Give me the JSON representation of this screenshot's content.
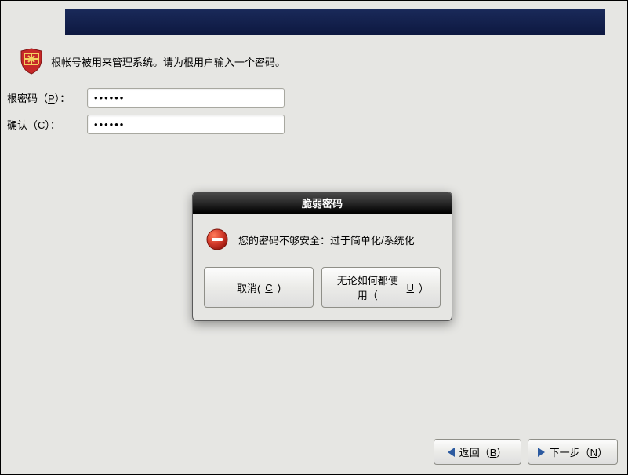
{
  "banner": {
    "title": ""
  },
  "intro": {
    "icon": "shield-icon",
    "text": "根帐号被用来管理系统。请为根用户输入一个密码。"
  },
  "form": {
    "root_password": {
      "label_prefix": "根密码（",
      "accel": "P",
      "label_suffix": "）：",
      "value": "••••••"
    },
    "confirm": {
      "label_prefix": "确认（",
      "accel": "C",
      "label_suffix": "）：",
      "value": "••••••"
    }
  },
  "dialog": {
    "title": "脆弱密码",
    "message": "您的密码不够安全：过于简单化/系统化",
    "cancel": {
      "prefix": "取消(",
      "accel": "C",
      "suffix": ")"
    },
    "use_anyway": {
      "prefix": "无论如何都使用（",
      "accel": "U",
      "suffix": "）"
    }
  },
  "footer": {
    "back": {
      "prefix": "返回（",
      "accel": "B",
      "suffix": "）"
    },
    "next": {
      "prefix": "下一步（",
      "accel": "N",
      "suffix": "）"
    }
  },
  "colors": {
    "banner_bg": "#12245a",
    "button_border": "#8f8f88",
    "arrow": "#2c5aa0",
    "error_red": "#d23a2a"
  }
}
